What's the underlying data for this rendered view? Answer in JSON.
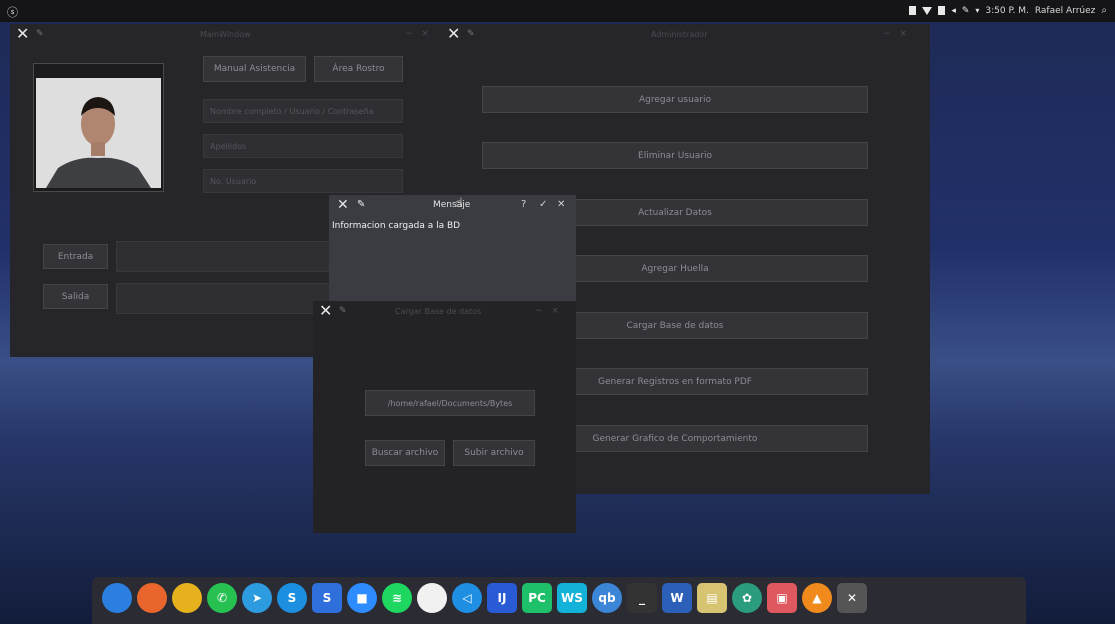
{
  "topbar": {
    "left_glyph": "ⓢ",
    "clock": "3:50 P. M.",
    "user": "Rafael Arrúez",
    "tray_icons": [
      "network-icon",
      "wifi-icon",
      "battery-icon",
      "volume-icon",
      "pen-icon",
      "dropdown-icon"
    ]
  },
  "win_left": {
    "title": "MainWindow",
    "buttons": {
      "manual": "Manual Asistencia",
      "area": "Área Rostro",
      "entrada": "Entrada",
      "salida": "Salida"
    },
    "fields": {
      "f1": "Nombre completo / Usuario / Contraseña",
      "f2": "Apellidos",
      "f3": "No. Usuario"
    }
  },
  "win_right": {
    "title": "Administrador",
    "buttons": [
      "Agregar usuario",
      "Eliminar Usuario",
      "Actualizar Datos",
      "Agregar Huella",
      "Cargar Base de datos",
      "Generar Registros en formato PDF",
      "Generar Grafico de Comportamiento"
    ]
  },
  "win_file": {
    "title": "Cargar Base de datos",
    "path": "/home/rafael/Documents/Bytes",
    "buttons": {
      "search": "Buscar archivo",
      "load": "Subir archivo"
    }
  },
  "dialog": {
    "title": "Mensaje",
    "message": "Informacion cargada a la BD",
    "controls": [
      "?",
      "✓",
      "✕"
    ]
  },
  "dock": {
    "apps": [
      {
        "name": "finder-icon",
        "color": "#2a7fe0",
        "glyph": ""
      },
      {
        "name": "firefox-icon",
        "color": "#e8652b",
        "glyph": ""
      },
      {
        "name": "chrome-icon",
        "color": "#e5b21d",
        "glyph": ""
      },
      {
        "name": "whatsapp-icon",
        "color": "#27c152",
        "glyph": "✆"
      },
      {
        "name": "telegram-icon",
        "color": "#2c9be0",
        "glyph": "➤"
      },
      {
        "name": "skype-icon",
        "color": "#1c8fe0",
        "glyph": "S"
      },
      {
        "name": "slides-icon",
        "color": "#2f6fdc",
        "glyph": "S"
      },
      {
        "name": "zoom-icon",
        "color": "#2d8cff",
        "glyph": "■"
      },
      {
        "name": "spotify-icon",
        "color": "#1ed760",
        "glyph": "≋"
      },
      {
        "name": "mongodb-icon",
        "color": "#f1f1f1",
        "glyph": ""
      },
      {
        "name": "vscode-icon",
        "color": "#1f8fe3",
        "glyph": "◁"
      },
      {
        "name": "intellij-icon",
        "color": "#2a5bd6",
        "glyph": "IJ"
      },
      {
        "name": "pycharm-icon",
        "color": "#1ec06a",
        "glyph": "PC"
      },
      {
        "name": "webstorm-icon",
        "color": "#13b2d9",
        "glyph": "WS"
      },
      {
        "name": "qbittorrent-icon",
        "color": "#3c86d8",
        "glyph": "qb"
      },
      {
        "name": "terminal-icon",
        "color": "#333",
        "glyph": "_"
      },
      {
        "name": "word-icon",
        "color": "#2b5fb8",
        "glyph": "W"
      },
      {
        "name": "files-icon",
        "color": "#d6c473",
        "glyph": "▤"
      },
      {
        "name": "fan-icon",
        "color": "#2b9c7e",
        "glyph": "✿"
      },
      {
        "name": "image-viewer-icon",
        "color": "#e0585f",
        "glyph": "▣"
      },
      {
        "name": "vlc-icon",
        "color": "#f08a1c",
        "glyph": "▲"
      },
      {
        "name": "x-app-icon",
        "color": "#555",
        "glyph": "✕"
      }
    ]
  }
}
